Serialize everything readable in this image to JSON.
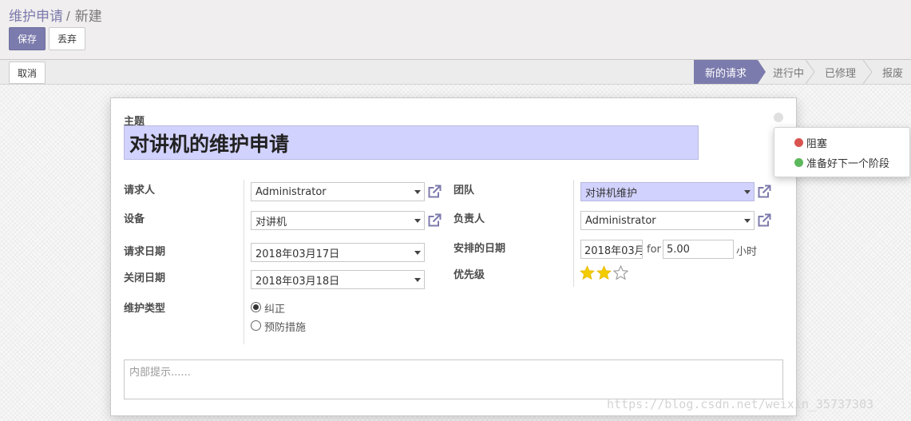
{
  "breadcrumb": {
    "parent": "维护申请",
    "separator": "/",
    "current": "新建"
  },
  "control_buttons": {
    "save": "保存",
    "discard": "丢弃"
  },
  "statusbar": {
    "cancel": "取消",
    "stages": [
      {
        "label": "新的请求",
        "active": true
      },
      {
        "label": "进行中",
        "active": false
      },
      {
        "label": "已修理",
        "active": false
      },
      {
        "label": "报废",
        "active": false
      }
    ]
  },
  "form": {
    "subject_label": "主题",
    "subject_value": "对讲机的维护申请",
    "requester_label": "请求人",
    "requester_value": "Administrator",
    "equipment_label": "设备",
    "equipment_value": "对讲机",
    "request_date_label": "请求日期",
    "request_date_value": "2018年03月17日",
    "close_date_label": "关闭日期",
    "close_date_value": "2018年03月18日",
    "maintenance_type_label": "维护类型",
    "maintenance_types": [
      {
        "label": "纠正",
        "checked": true
      },
      {
        "label": "预防措施",
        "checked": false
      }
    ],
    "team_label": "团队",
    "team_value": "对讲机维护",
    "responsible_label": "负责人",
    "responsible_value": "Administrator",
    "scheduled_date_label": "安排的日期",
    "scheduled_date_value": "2018年03月",
    "for_label": "for",
    "duration_value": "5.00",
    "duration_unit": "小时",
    "priority_label": "优先级",
    "priority": {
      "filled": 2,
      "max": 3
    },
    "notes_placeholder": "内部提示......"
  },
  "kanban_state_popup": {
    "items": [
      {
        "label": "阻塞",
        "color": "#d9534f"
      },
      {
        "label": "准备好下一个阶段",
        "color": "#5cb85c"
      }
    ]
  },
  "colors": {
    "primary": "#7c7bad",
    "highlight_field": "#d2d2ff"
  },
  "watermark": "https://blog.csdn.net/weixin_35737303"
}
